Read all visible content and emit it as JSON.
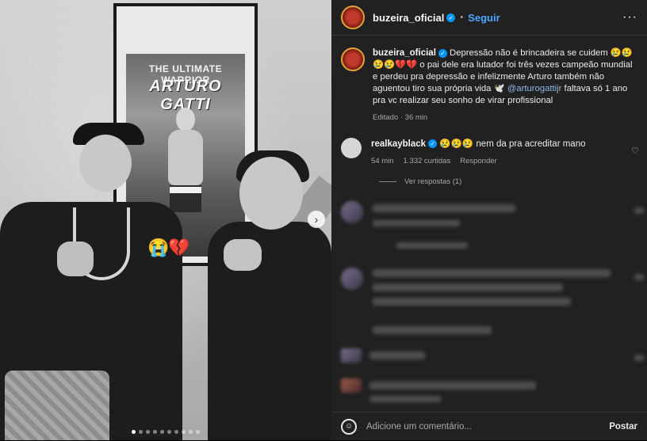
{
  "photo": {
    "poster_top": "THE ULTIMATE WARRIOR",
    "poster_name": "ARTURO GATTI",
    "stickers": [
      "😭",
      "💔"
    ],
    "next_arrow": "›",
    "carousel_dots": 10,
    "active_dot": 1
  },
  "header": {
    "username": "buzeira_oficial",
    "separator": "•",
    "follow_label": "Seguir",
    "more_label": "···"
  },
  "caption": {
    "username": "buzeira_oficial",
    "text_1": " Depressão não é brincadeira se cuidem 😢😢😢😢💔💔 o pai dele era lutador foi três vezes campeão mundial e perdeu pra depressão e infelizmente Arturo também não aguentou tiro sua própria vida 🕊️ ",
    "mention": "@arturogattijr",
    "text_2": " faltava só 1 ano pra vc realizar seu sonho de virar profissional",
    "meta": "Editado · 36 min"
  },
  "comment": {
    "username": "realkayblack",
    "text": " 😢😢😢 nem da pra acreditar mano",
    "time": "54 min",
    "likes": "1.332 curtidas",
    "reply_label": "Responder",
    "heart": "♡"
  },
  "replies": {
    "label": "Ver respostas (1)"
  },
  "footer": {
    "emoji_icon": "☺",
    "placeholder": "Adicione um comentário...",
    "post_label": "Postar"
  },
  "colors": {
    "panel_bg": "#212121",
    "accent": "#0095f6",
    "link": "#4aa8ff"
  }
}
